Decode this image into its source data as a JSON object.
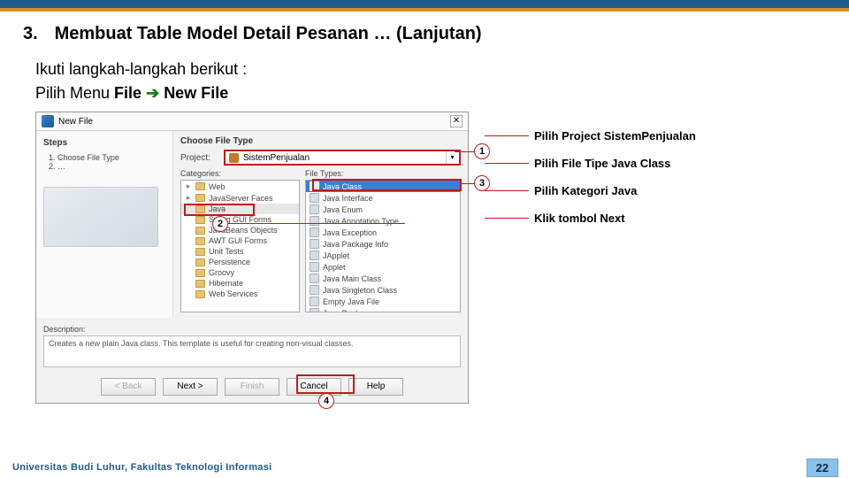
{
  "slide": {
    "number": "3.",
    "title": "Membuat Table Model Detail Pesanan … (Lanjutan)",
    "intro": "Ikuti langkah-langkah berikut :",
    "intro2_prefix": "Pilih Menu ",
    "intro2_b1": "File",
    "intro2_arrow": "➔",
    "intro2_b2": "New File",
    "page": "22",
    "footer": "Universitas Budi Luhur, Fakultas Teknologi Informasi"
  },
  "dialog": {
    "title": "New File",
    "close": "✕",
    "steps_title": "Steps",
    "steps": [
      "Choose File Type",
      "…"
    ],
    "choose_title": "Choose File Type",
    "project_label": "Project:",
    "project_value": "SistemPenjualan",
    "categories_label": "Categories:",
    "filetypes_label": "File Types:",
    "categories": [
      "Web",
      "JavaServer Faces",
      "Java",
      "Swing GUI Forms",
      "JavaBeans Objects",
      "AWT GUI Forms",
      "Unit Tests",
      "Persistence",
      "Groovy",
      "Hibernate",
      "Web Services"
    ],
    "file_types": [
      "Java Class",
      "Java Interface",
      "Java Enum",
      "Java Annotation Type",
      "Java Exception",
      "Java Package Info",
      "JApplet",
      "Applet",
      "Java Main Class",
      "Java Singleton Class",
      "Empty Java File",
      "Java Package"
    ],
    "description_label": "Description:",
    "description": "Creates a new plain Java class. This template is useful for creating non-visual classes.",
    "buttons": {
      "back": "< Back",
      "next": "Next >",
      "finish": "Finish",
      "cancel": "Cancel",
      "help": "Help"
    }
  },
  "callouts": {
    "c1": "Pilih Project SistemPenjualan",
    "c2": "Pilih File Tipe Java Class",
    "c3": "Pilih Kategori Java",
    "c4": "Klik tombol Next"
  },
  "markers": {
    "m1": "1",
    "m2": "2",
    "m3": "3",
    "m4": "4"
  }
}
